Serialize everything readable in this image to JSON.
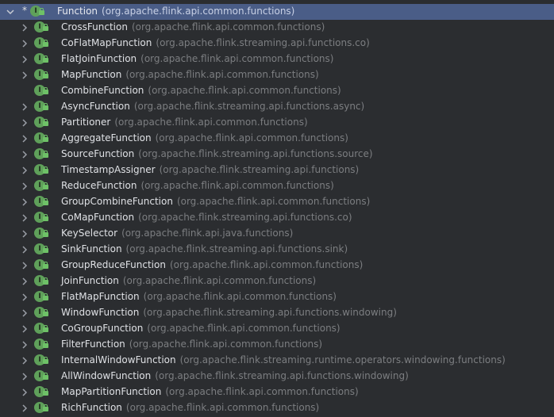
{
  "root": {
    "name": "Function",
    "package": "(org.apache.flink.api.common.functions)",
    "marker": "*"
  },
  "icon_letter": "I",
  "colors": {
    "background": "#2b2d30",
    "selection": "#4a5d87",
    "interface_icon": "#5fa05a",
    "text": "#dfe1e5",
    "package_text": "#7c7e81"
  },
  "items": [
    {
      "name": "CrossFunction",
      "package": "(org.apache.flink.api.common.functions)",
      "expandable": true
    },
    {
      "name": "CoFlatMapFunction",
      "package": "(org.apache.flink.streaming.api.functions.co)",
      "expandable": true
    },
    {
      "name": "FlatJoinFunction",
      "package": "(org.apache.flink.api.common.functions)",
      "expandable": true
    },
    {
      "name": "MapFunction",
      "package": "(org.apache.flink.api.common.functions)",
      "expandable": true
    },
    {
      "name": "CombineFunction",
      "package": "(org.apache.flink.api.common.functions)",
      "expandable": false
    },
    {
      "name": "AsyncFunction",
      "package": "(org.apache.flink.streaming.api.functions.async)",
      "expandable": true
    },
    {
      "name": "Partitioner",
      "package": "(org.apache.flink.api.common.functions)",
      "expandable": true
    },
    {
      "name": "AggregateFunction",
      "package": "(org.apache.flink.api.common.functions)",
      "expandable": true
    },
    {
      "name": "SourceFunction",
      "package": "(org.apache.flink.streaming.api.functions.source)",
      "expandable": true
    },
    {
      "name": "TimestampAssigner",
      "package": "(org.apache.flink.streaming.api.functions)",
      "expandable": true
    },
    {
      "name": "ReduceFunction",
      "package": "(org.apache.flink.api.common.functions)",
      "expandable": true
    },
    {
      "name": "GroupCombineFunction",
      "package": "(org.apache.flink.api.common.functions)",
      "expandable": true
    },
    {
      "name": "CoMapFunction",
      "package": "(org.apache.flink.streaming.api.functions.co)",
      "expandable": true
    },
    {
      "name": "KeySelector",
      "package": "(org.apache.flink.api.java.functions)",
      "expandable": true
    },
    {
      "name": "SinkFunction",
      "package": "(org.apache.flink.streaming.api.functions.sink)",
      "expandable": true
    },
    {
      "name": "GroupReduceFunction",
      "package": "(org.apache.flink.api.common.functions)",
      "expandable": true
    },
    {
      "name": "JoinFunction",
      "package": "(org.apache.flink.api.common.functions)",
      "expandable": true
    },
    {
      "name": "FlatMapFunction",
      "package": "(org.apache.flink.api.common.functions)",
      "expandable": true
    },
    {
      "name": "WindowFunction",
      "package": "(org.apache.flink.streaming.api.functions.windowing)",
      "expandable": true
    },
    {
      "name": "CoGroupFunction",
      "package": "(org.apache.flink.api.common.functions)",
      "expandable": true
    },
    {
      "name": "FilterFunction",
      "package": "(org.apache.flink.api.common.functions)",
      "expandable": true
    },
    {
      "name": "InternalWindowFunction",
      "package": "(org.apache.flink.streaming.runtime.operators.windowing.functions)",
      "expandable": true
    },
    {
      "name": "AllWindowFunction",
      "package": "(org.apache.flink.streaming.api.functions.windowing)",
      "expandable": true
    },
    {
      "name": "MapPartitionFunction",
      "package": "(org.apache.flink.api.common.functions)",
      "expandable": true
    },
    {
      "name": "RichFunction",
      "package": "(org.apache.flink.api.common.functions)",
      "expandable": true
    }
  ]
}
